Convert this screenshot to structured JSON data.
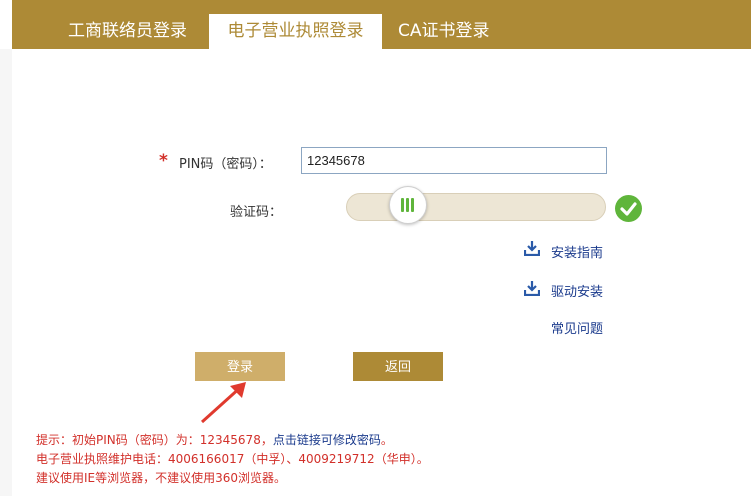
{
  "tabs": [
    {
      "label": "工商联络员登录",
      "active": false
    },
    {
      "label": "电子营业执照登录",
      "active": true
    },
    {
      "label": "CA证书登录",
      "active": false
    }
  ],
  "form": {
    "required_mark": "*",
    "pin_label": "PIN码（密码）：",
    "pin_value": "12345678",
    "captcha_label": "验证码：",
    "captcha_verified": true
  },
  "links": {
    "install_guide": "安装指南",
    "driver_install": "驱动安装",
    "faq": "常见问题"
  },
  "buttons": {
    "login": "登录",
    "back": "返回"
  },
  "tips": {
    "line1_prefix": "提示：初始PIN码（密码）为：12345678，",
    "line1_link": "点击链接可修改密码",
    "line1_suffix": "。",
    "line2": "电子营业执照维护电话：4006166017（中孚）、4009219712（华申）。",
    "line3": "建议使用IE等浏览器，不建议使用360浏览器。"
  },
  "colors": {
    "brand": "#ad8a36",
    "login_button": "#cfae6a",
    "tip_red": "#d2302a",
    "link_blue": "#1a3a8c",
    "success_green": "#5fb53b"
  },
  "icons": {
    "download": "download-icon",
    "check": "check-circle-icon",
    "slider": "slider-grip-icon",
    "annotation": "red-arrow-annotation"
  }
}
